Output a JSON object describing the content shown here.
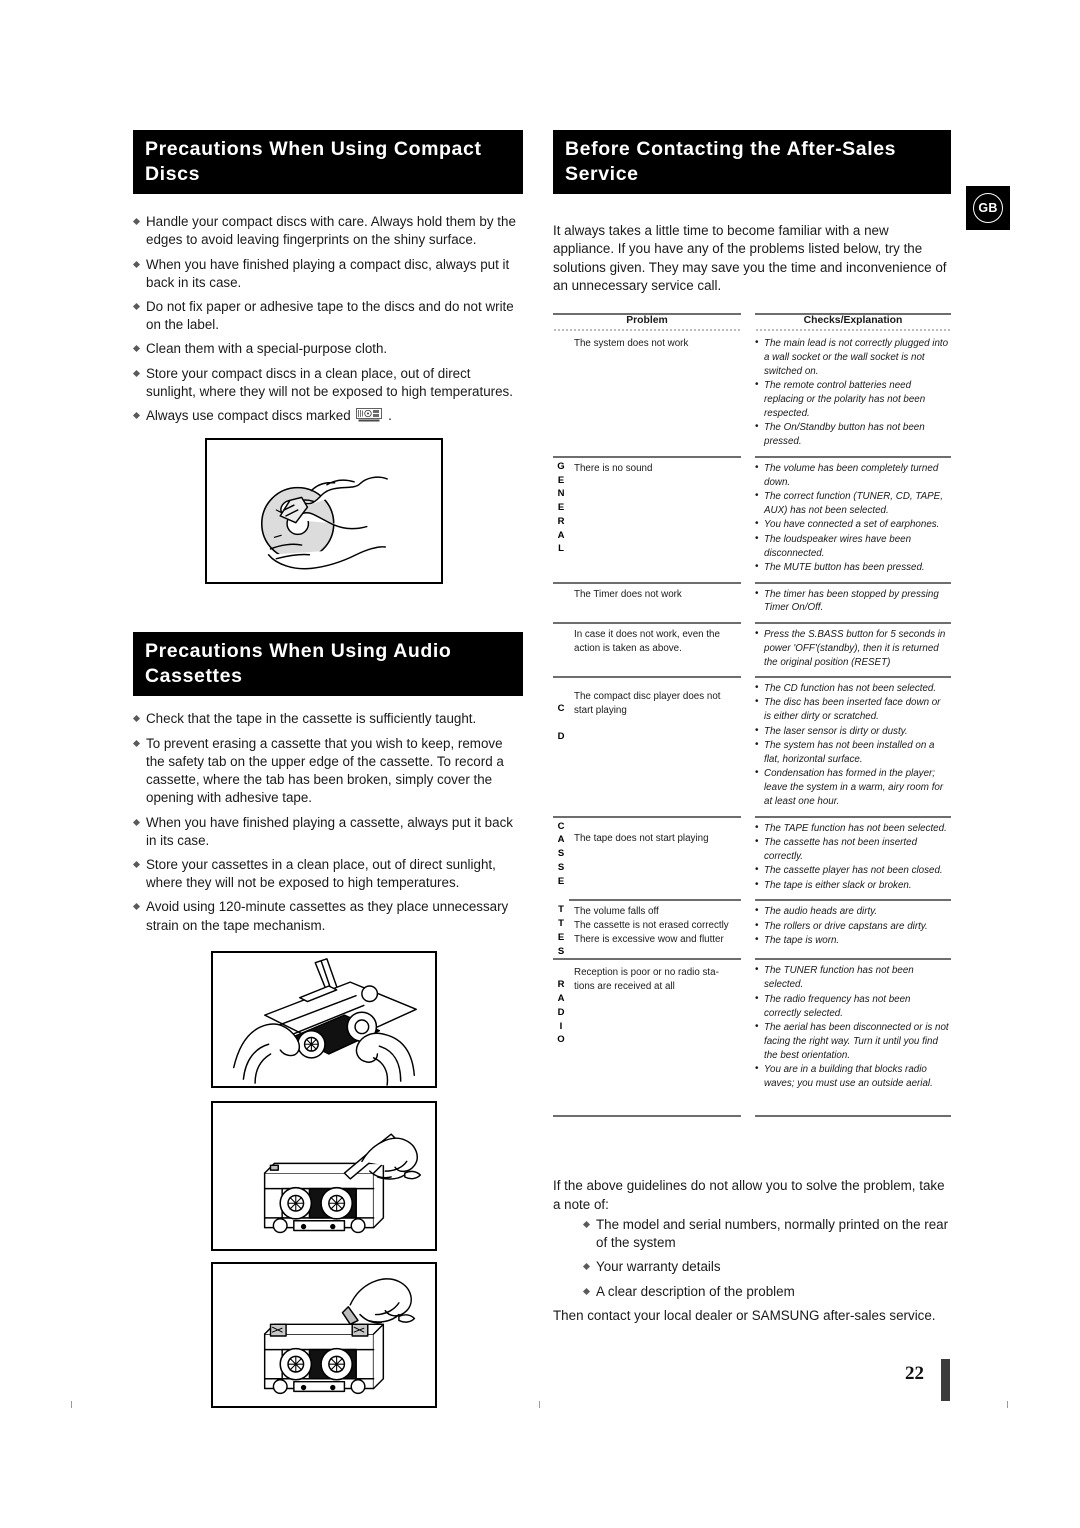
{
  "page": {
    "number": "22",
    "region_badge": "GB"
  },
  "left_column": {
    "section_cd": {
      "heading_line1": "Precautions When Using Compact",
      "heading_line2": "Discs",
      "bullets": [
        "Handle your compact discs with care. Always hold them by the edges to avoid leaving fingerprints on the shiny surface.",
        "When you have finished playing a compact disc, always put it back in its case.",
        "Do not fix paper or adhesive tape to the discs and do not write on the label.",
        "Clean them with a special-purpose cloth.",
        "Store your compact discs in a clean place, out of direct sunlight, where they will not be exposed to high temperatures."
      ],
      "last_bullet_prefix": "Always use compact discs marked",
      "last_bullet_suffix": ".",
      "figure_caption": "hands-cleaning-compact-disc-illustration"
    },
    "section_cassette": {
      "heading_line1": "Precautions When Using Audio",
      "heading_line2": "Cassettes",
      "bullets": [
        "Check that the tape in the cassette is sufficiently taught.",
        "To prevent erasing a cassette that you wish to keep, remove the safety tab on the upper edge of the cassette. To record a cassette, where  the tab has been broken, simply cover the opening with adhesive tape.",
        "When you have finished playing a cassette, always put it back in its case.",
        "Store your cassettes in a clean place, out of direct sunlight, where they will not be exposed to high temperatures.",
        "Avoid using 120-minute cassettes as they place unnecessary strain on the tape mechanism."
      ],
      "figures": [
        "hands-tightening-cassette-tape-with-pencil-illustration",
        "hand-breaking-safety-tab-with-screwdriver-illustration",
        "hand-covering-tab-openings-with-adhesive-tape-illustration"
      ]
    }
  },
  "right_column": {
    "heading_line1": "Before Contacting the After-Sales",
    "heading_line2": "Service",
    "intro": "It always takes a little time to become familiar with a new appliance. If you have any of the problems listed below, try the solutions given. They may save you the time and inconvenience of an unnecessary service call.",
    "table": {
      "headers": {
        "problem": "Problem",
        "checks": "Checks/Explanation"
      },
      "rows": [
        {
          "category": "",
          "problem": [
            "The system does not work"
          ],
          "checks": [
            "The main lead is not correctly plugged into a wall socket or the wall socket is not switched on.",
            "The remote control batteries need replacing or the polarity has not been respected.",
            "The  On/Standby button has not been pressed."
          ]
        },
        {
          "category": "GENERAL",
          "problem": [
            "There is no sound"
          ],
          "checks": [
            "The volume has been completely turned down.",
            "The correct function (TUNER, CD, TAPE, AUX) has not been selected.",
            "You have connected a set of earphones.",
            "The loudspeaker wires have been disconnected.",
            "The MUTE button has been pressed."
          ]
        },
        {
          "category": "",
          "problem": [
            "The Timer does not work"
          ],
          "checks": [
            "The timer has been stopped by pressing Timer On/Off."
          ]
        },
        {
          "category": "",
          "problem": [
            "In case it does not work, even the action is taken as above."
          ],
          "checks": [
            "Press the S.BASS button for 5 seconds in power 'OFF'(standby), then it is returned the original position (RESET)"
          ]
        },
        {
          "category": "CD",
          "problem": [
            "The compact disc player does not start playing"
          ],
          "checks": [
            "The CD function has not been selected.",
            "The disc has been inserted face down or is either dirty or scratched.",
            "The laser sensor is dirty or dusty.",
            "The system has not been installed on a flat, horizontal surface.",
            "Condensation has formed in the player; leave the system in a warm, airy room for at least one hour."
          ]
        },
        {
          "category": "CASSETTES-A",
          "problem": [
            "The tape does not start playing"
          ],
          "checks": [
            "The TAPE function has not been selected.",
            "The cassette has not been inserted correctly.",
            "The cassette player has not been closed.",
            "The tape is either slack or broken."
          ]
        },
        {
          "category": "CASSETTES-B",
          "problem": [
            "The volume falls off",
            "The cassette is not erased correctly",
            "There is excessive wow and flutter"
          ],
          "checks": [
            "The audio heads are dirty.",
            "The rollers or drive capstans are dirty.",
            "The tape is worn."
          ]
        },
        {
          "category": "RADIO",
          "problem": [
            "Reception is poor or no radio sta- tions are received at all"
          ],
          "checks": [
            "The TUNER function has not been selected.",
            "The radio frequency has not been correctly selected.",
            "The aerial has been disconnected or is not facing the right way. Turn it until you find the best orientation.",
            "You are in a building that blocks radio waves; you must use an outside aerial."
          ]
        }
      ],
      "category_labels": {
        "general": [
          "G",
          "E",
          "N",
          "E",
          "R",
          "A",
          "L"
        ],
        "cd": [
          "C",
          "D"
        ],
        "cassettes": [
          "C",
          "A",
          "S",
          "S",
          "E",
          "T",
          "T",
          "E",
          "S"
        ],
        "radio": [
          "R",
          "A",
          "D",
          "I",
          "O"
        ]
      }
    },
    "closing": {
      "lead": "If the above guidelines do not allow you to solve the problem, take a note of:",
      "bullets": [
        "The model and serial numbers, normally printed on the rear of the system",
        "Your warranty details",
        "A clear description of the problem"
      ],
      "tail": "Then contact your local dealer or SAMSUNG after-sales service."
    }
  }
}
